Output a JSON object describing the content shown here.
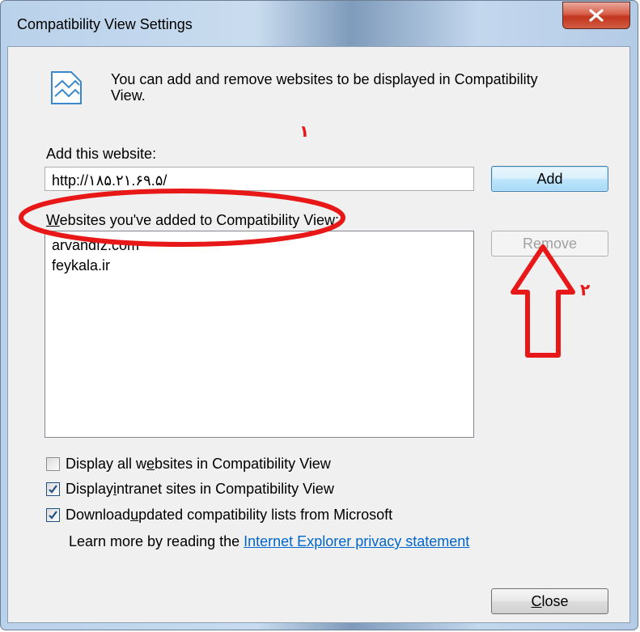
{
  "window": {
    "title": "Compatibility View Settings"
  },
  "intro": {
    "text": "You can add and remove websites to be displayed in Compatibility View."
  },
  "add_section": {
    "label": "Add this website:",
    "input_value": "http://۱۸۵.۲۱.۶۹.۵/",
    "add_button": "Add"
  },
  "list_section": {
    "label_prefix": "",
    "label_accel": "W",
    "label_rest": "ebsites you've added to Compatibility View:",
    "items": [
      "arvandfz.com",
      "feykala.ir"
    ],
    "remove_button": "Remove"
  },
  "options": [
    {
      "before": "Display all w",
      "accel": "e",
      "after": "bsites in Compatibility View",
      "checked": false
    },
    {
      "before": "Display ",
      "accel": "i",
      "after": "ntranet sites in Compatibility View",
      "checked": true
    },
    {
      "before": "Download ",
      "accel": "u",
      "after": "pdated compatibility lists from Microsoft",
      "checked": true
    }
  ],
  "learn_more": {
    "text": "Learn more by reading the ",
    "link": "Internet Explorer privacy statement"
  },
  "close_button": {
    "accel": "C",
    "rest": "lose"
  },
  "annotations": {
    "marker_1": "۱",
    "marker_2": "۲",
    "color": "#e81818"
  }
}
